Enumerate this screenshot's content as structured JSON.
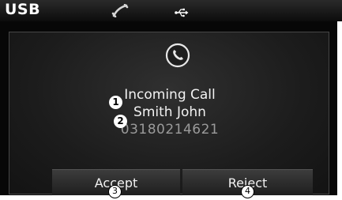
{
  "statusbar": {
    "label": "USB",
    "phone_icon": "phone-handset-icon",
    "usb_icon": "usb-icon"
  },
  "popup": {
    "icon": "phone-call-icon",
    "title": "Incoming Call",
    "caller_name": "Smith John",
    "caller_number": "03180214621"
  },
  "buttons": {
    "accept": "Accept",
    "reject": "Reject"
  },
  "callouts": [
    "1",
    "2",
    "3",
    "4"
  ]
}
